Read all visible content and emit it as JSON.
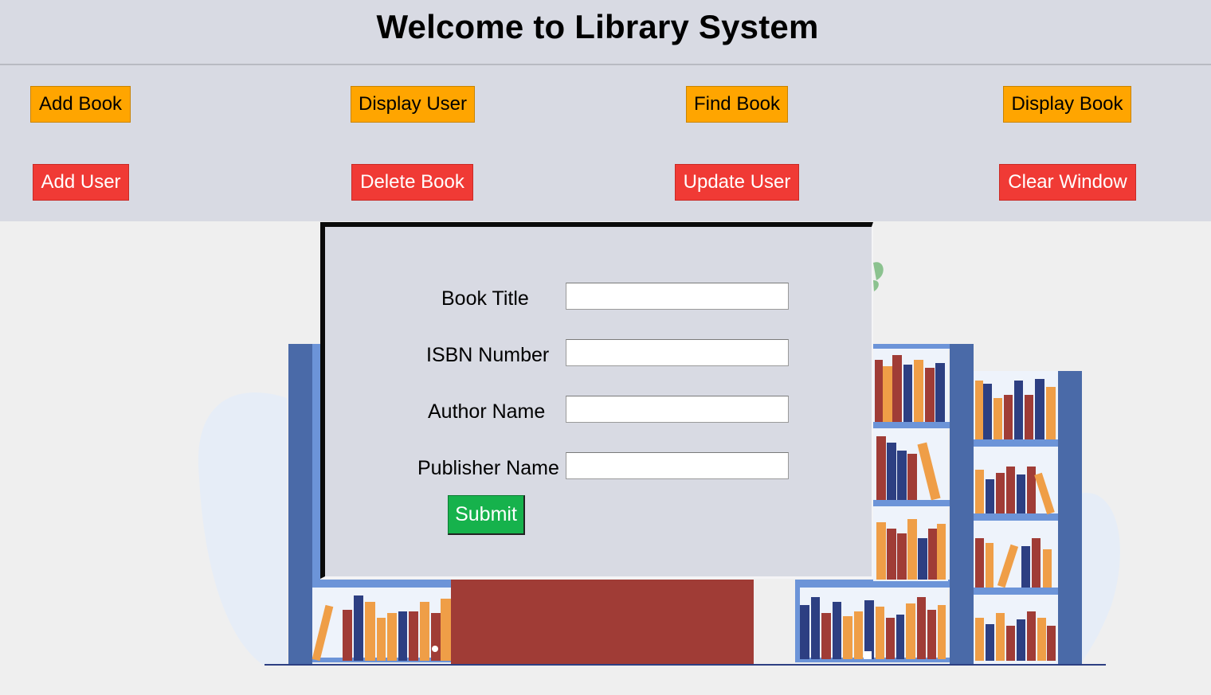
{
  "header": {
    "title": "Welcome to Library System"
  },
  "toolbar": {
    "add_book": "Add Book",
    "display_user": "Display User",
    "find_book": "Find Book",
    "display_book": "Display Book",
    "add_user": "Add User",
    "delete_book": "Delete Book",
    "update_user": "Update User",
    "clear_window": "Clear Window"
  },
  "form": {
    "fields": [
      {
        "label": "Book Title",
        "value": ""
      },
      {
        "label": "ISBN Number",
        "value": ""
      },
      {
        "label": "Author Name",
        "value": ""
      },
      {
        "label": "Publisher Name",
        "value": ""
      }
    ],
    "submit_label": "Submit"
  },
  "colors": {
    "header_bg": "#d8dae3",
    "action_button": "#ffa500",
    "danger_button": "#f03a35",
    "submit_button": "#16b24c",
    "shelf_blue": "#4a6aa8",
    "desk_red": "#a03c36"
  }
}
